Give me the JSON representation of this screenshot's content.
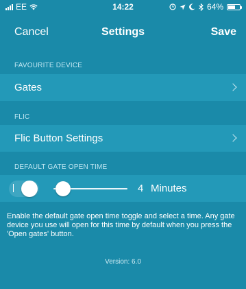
{
  "status_bar": {
    "carrier": "EE",
    "time": "14:22",
    "battery_percent": "64%",
    "battery_level": 0.64,
    "icons": [
      "signal-icon",
      "wifi-icon",
      "alarm-icon",
      "location-icon",
      "do-not-disturb-icon",
      "bluetooth-icon",
      "battery-icon"
    ]
  },
  "nav": {
    "cancel_label": "Cancel",
    "title": "Settings",
    "save_label": "Save"
  },
  "sections": {
    "favourite_device": {
      "header": "FAVOURITE DEVICE",
      "row_label": "Gates"
    },
    "flic": {
      "header": "FLIC",
      "row_label": "Flic Button Settings"
    },
    "default_gate_open_time": {
      "header": "DEFAULT GATE OPEN TIME",
      "toggle_on": true,
      "slider_value": "4",
      "slider_unit": "Minutes",
      "slider_fraction": 0.04
    }
  },
  "description": "Enable the default gate open time toggle and select a time. Any gate device you use will open for this time by default when you press the 'Open gates' button.",
  "version": "Version: 6.0",
  "colors": {
    "background": "#1a8aa9",
    "row_background": "#2399b8",
    "text": "#ffffff"
  }
}
